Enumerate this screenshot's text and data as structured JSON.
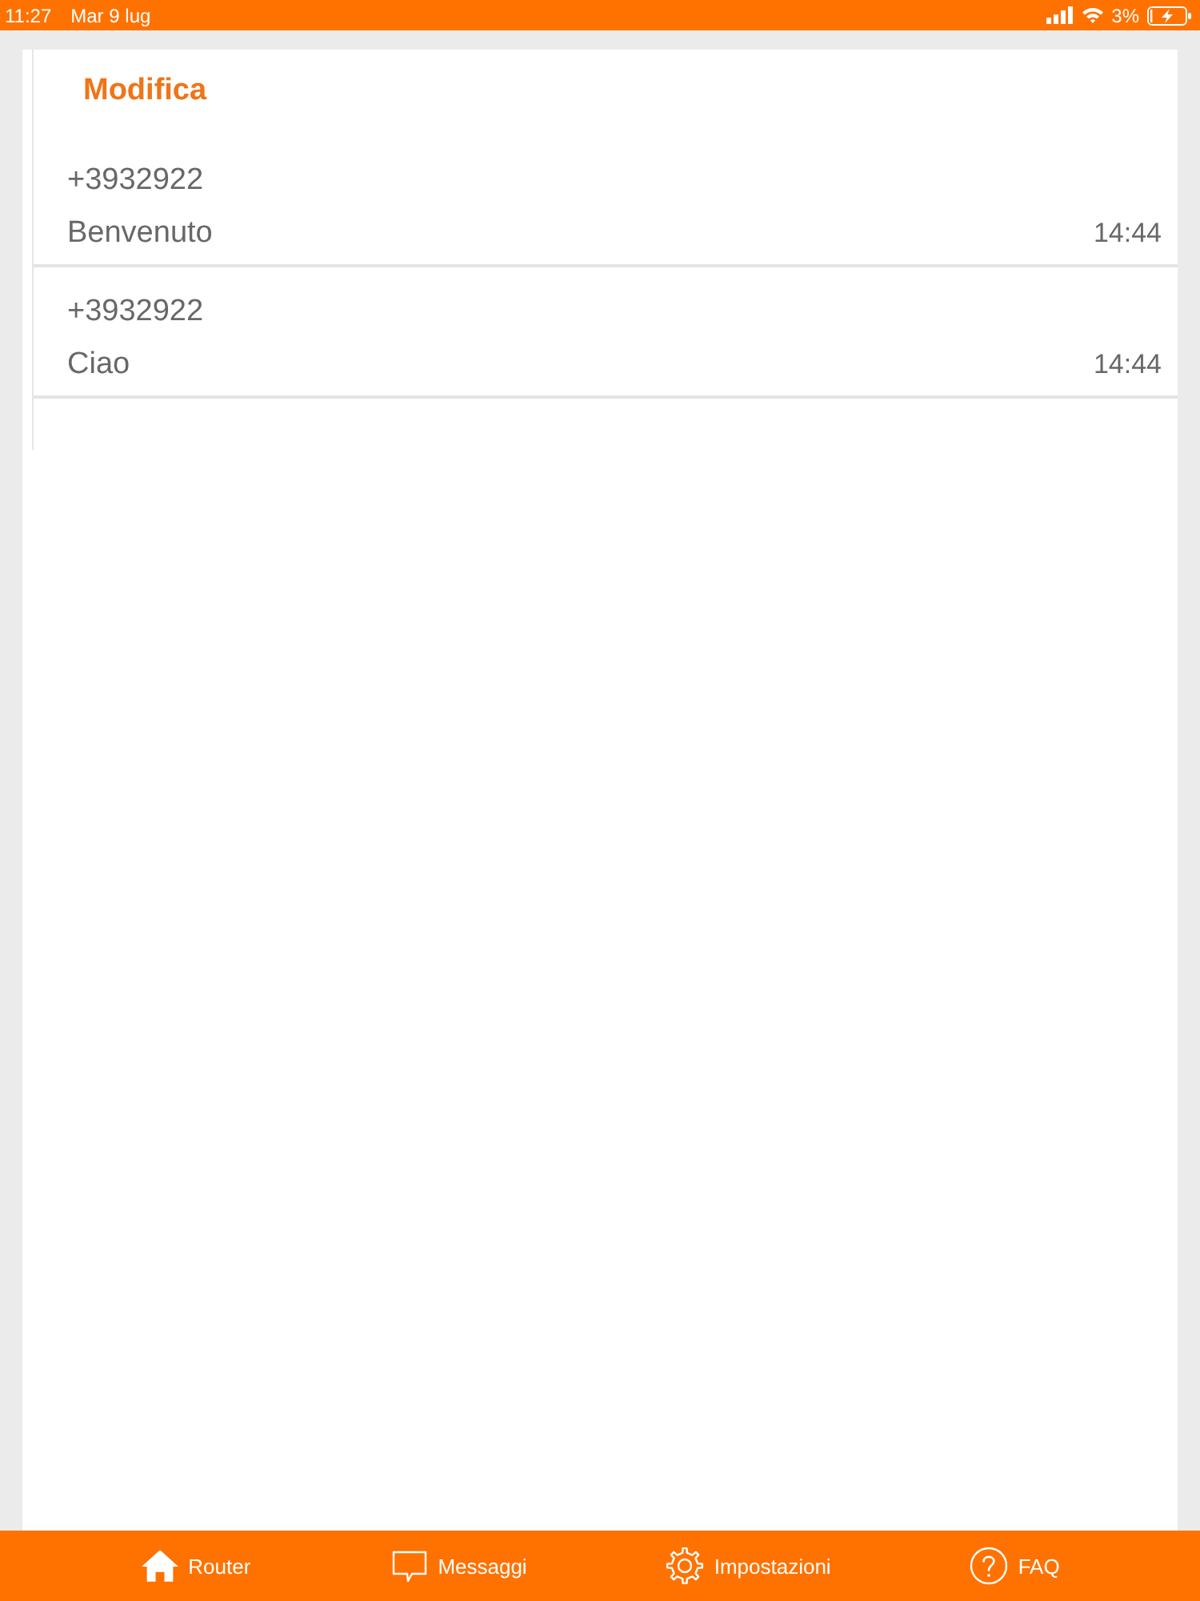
{
  "status_bar": {
    "time": "11:27",
    "date": "Mar 9 lug",
    "battery_text": "3%",
    "charging": true
  },
  "header": {
    "edit_button": "Modifica"
  },
  "messages": [
    {
      "sender": "+3932922",
      "text": "Benvenuto",
      "time": "14:44"
    },
    {
      "sender": "+3932922",
      "text": "Ciao",
      "time": "14:44"
    }
  ],
  "tab_bar": [
    {
      "label": "Router",
      "kind": "home"
    },
    {
      "label": "Messaggi",
      "kind": "chat"
    },
    {
      "label": "Impostazioni",
      "kind": "settings"
    },
    {
      "label": "FAQ",
      "kind": "help"
    }
  ]
}
